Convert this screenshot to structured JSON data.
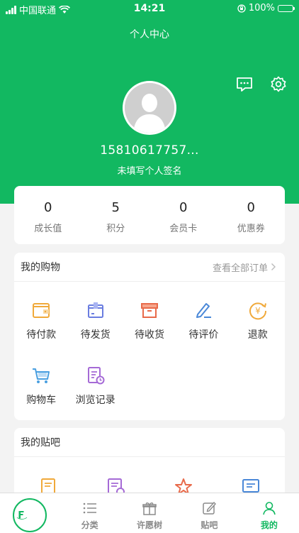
{
  "status_bar": {
    "carrier": "中国联通",
    "time": "14:21",
    "battery": "100%"
  },
  "header": {
    "title": "个人中心"
  },
  "profile": {
    "username": "15810617757...",
    "signature": "未填写个人签名"
  },
  "stats": [
    {
      "value": "0",
      "label": "成长值"
    },
    {
      "value": "5",
      "label": "积分"
    },
    {
      "value": "0",
      "label": "会员卡"
    },
    {
      "value": "0",
      "label": "优惠券"
    }
  ],
  "shopping": {
    "title": "我的购物",
    "view_all": "查看全部订单",
    "items": [
      {
        "label": "待付款",
        "icon": "wallet-icon"
      },
      {
        "label": "待发货",
        "icon": "box-icon"
      },
      {
        "label": "待收货",
        "icon": "package-icon"
      },
      {
        "label": "待评价",
        "icon": "pen-icon"
      },
      {
        "label": "退款",
        "icon": "refund-icon"
      },
      {
        "label": "购物车",
        "icon": "cart-icon"
      },
      {
        "label": "浏览记录",
        "icon": "history-icon"
      }
    ]
  },
  "tieba": {
    "title": "我的贴吧"
  },
  "tabbar": {
    "items": [
      {
        "label": "分类"
      },
      {
        "label": "许愿树"
      },
      {
        "label": "贴吧"
      },
      {
        "label": "我的"
      }
    ]
  },
  "colors": {
    "brand": "#12b861"
  }
}
